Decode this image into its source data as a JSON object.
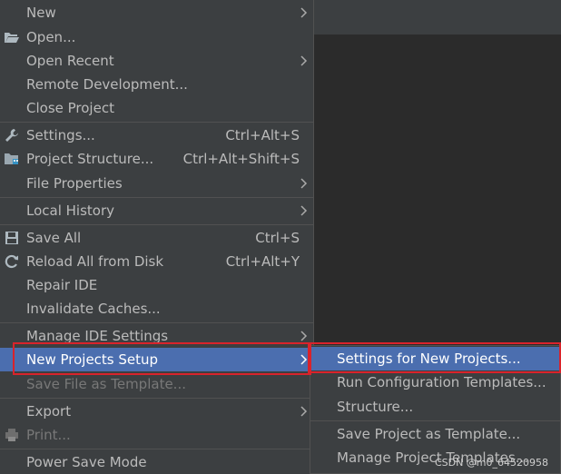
{
  "menu": {
    "new": "New",
    "open": "Open...",
    "open_recent": "Open Recent",
    "remote_dev": "Remote Development...",
    "close_project": "Close Project",
    "settings": "Settings...",
    "settings_sc": "Ctrl+Alt+S",
    "project_structure": "Project Structure...",
    "project_structure_sc": "Ctrl+Alt+Shift+S",
    "file_properties": "File Properties",
    "local_history": "Local History",
    "save_all": "Save All",
    "save_all_sc": "Ctrl+S",
    "reload": "Reload All from Disk",
    "reload_sc": "Ctrl+Alt+Y",
    "repair": "Repair IDE",
    "invalidate": "Invalidate Caches...",
    "manage_ide": "Manage IDE Settings",
    "new_projects_setup": "New Projects Setup",
    "save_template": "Save File as Template...",
    "export": "Export",
    "print": "Print...",
    "power_save": "Power Save Mode"
  },
  "submenu": {
    "settings_new": "Settings for New Projects...",
    "run_config": "Run Configuration Templates...",
    "structure": "Structure...",
    "save_project_template": "Save Project as Template...",
    "manage_templates": "Manage Project Templates..."
  },
  "watermark": "CSDN @m0_64520958",
  "colors": {
    "menu_bg": "#3c3f41",
    "selection": "#4b6eaf",
    "highlight_box": "#d9232b"
  }
}
